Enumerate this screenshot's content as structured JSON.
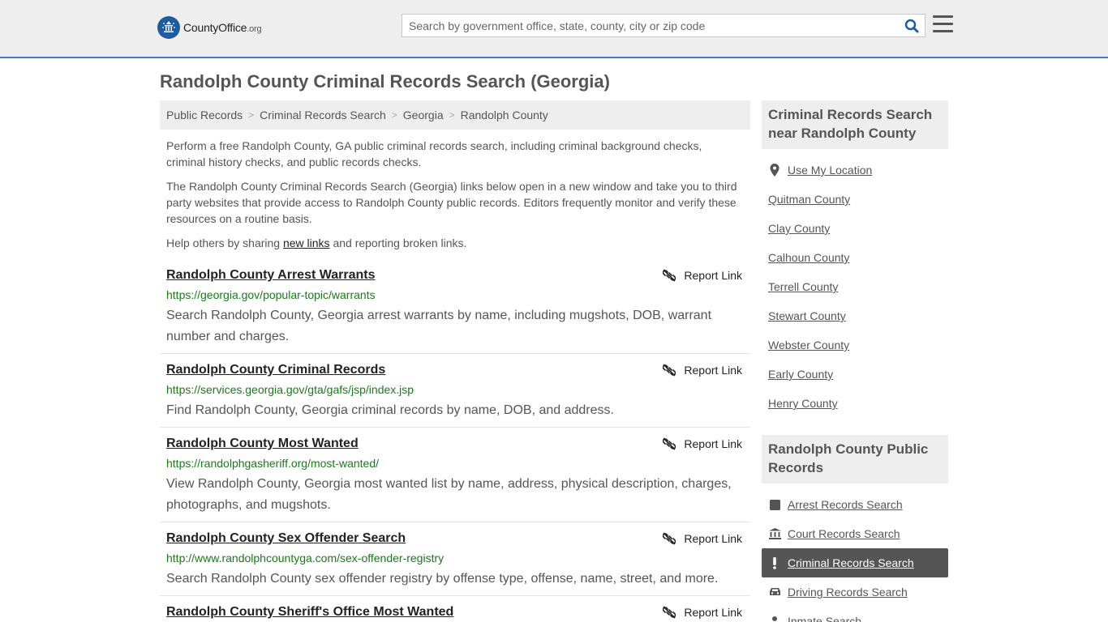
{
  "header": {
    "logo_main": "CountyOffice",
    "logo_suffix": ".org",
    "search_placeholder": "Search by government office, state, county, city or zip code"
  },
  "page": {
    "title": "Randolph County Criminal Records Search (Georgia)"
  },
  "breadcrumb": [
    "Public Records",
    "Criminal Records Search",
    "Georgia",
    "Randolph County"
  ],
  "intro": {
    "p1": "Perform a free Randolph County, GA public criminal records search, including criminal background checks, criminal history checks, and public records checks.",
    "p2": "The Randolph County Criminal Records Search (Georgia) links below open in a new window and take you to third party websites that provide access to Randolph County public records. Editors frequently monitor and verify these resources on a routine basis.",
    "p3_before": "Help others by sharing ",
    "p3_link": "new links",
    "p3_after": " and reporting broken links."
  },
  "report_label": "Report Link",
  "results": [
    {
      "title": "Randolph County Arrest Warrants",
      "url": "https://georgia.gov/popular-topic/warrants",
      "desc": "Search Randolph County, Georgia arrest warrants by name, including mugshots, DOB, warrant number and charges."
    },
    {
      "title": "Randolph County Criminal Records",
      "url": "https://services.georgia.gov/gta/gafs/jsp/index.jsp",
      "desc": "Find Randolph County, Georgia criminal records by name, DOB, and address."
    },
    {
      "title": "Randolph County Most Wanted",
      "url": "https://randolphgasheriff.org/most-wanted/",
      "desc": "View Randolph County, Georgia most wanted list by name, address, physical description, charges, photographs, and mugshots."
    },
    {
      "title": "Randolph County Sex Offender Search",
      "url": "http://www.randolphcountyga.com/sex-offender-registry",
      "desc": "Search Randolph County sex offender registry by offense type, offense, name, street, and more."
    },
    {
      "title": "Randolph County Sheriff's Office Most Wanted",
      "url": "",
      "desc": ""
    }
  ],
  "sidebar": {
    "nearby_heading": "Criminal Records Search near Randolph County",
    "use_location": "Use My Location",
    "nearby": [
      "Quitman County",
      "Clay County",
      "Calhoun County",
      "Terrell County",
      "Stewart County",
      "Webster County",
      "Early County",
      "Henry County"
    ],
    "public_heading": "Randolph County Public Records",
    "public_records": [
      {
        "label": "Arrest Records Search",
        "icon": "square-icon"
      },
      {
        "label": "Court Records Search",
        "icon": "courthouse-icon"
      },
      {
        "label": "Criminal Records Search",
        "icon": "exclamation-icon"
      },
      {
        "label": "Driving Records Search",
        "icon": "car-icon"
      },
      {
        "label": "Inmate Search",
        "icon": "inmate-icon"
      }
    ]
  },
  "colors": {
    "accent": "#3b7fc4",
    "url_green": "#1a7a1a",
    "active_bg": "#555555"
  }
}
